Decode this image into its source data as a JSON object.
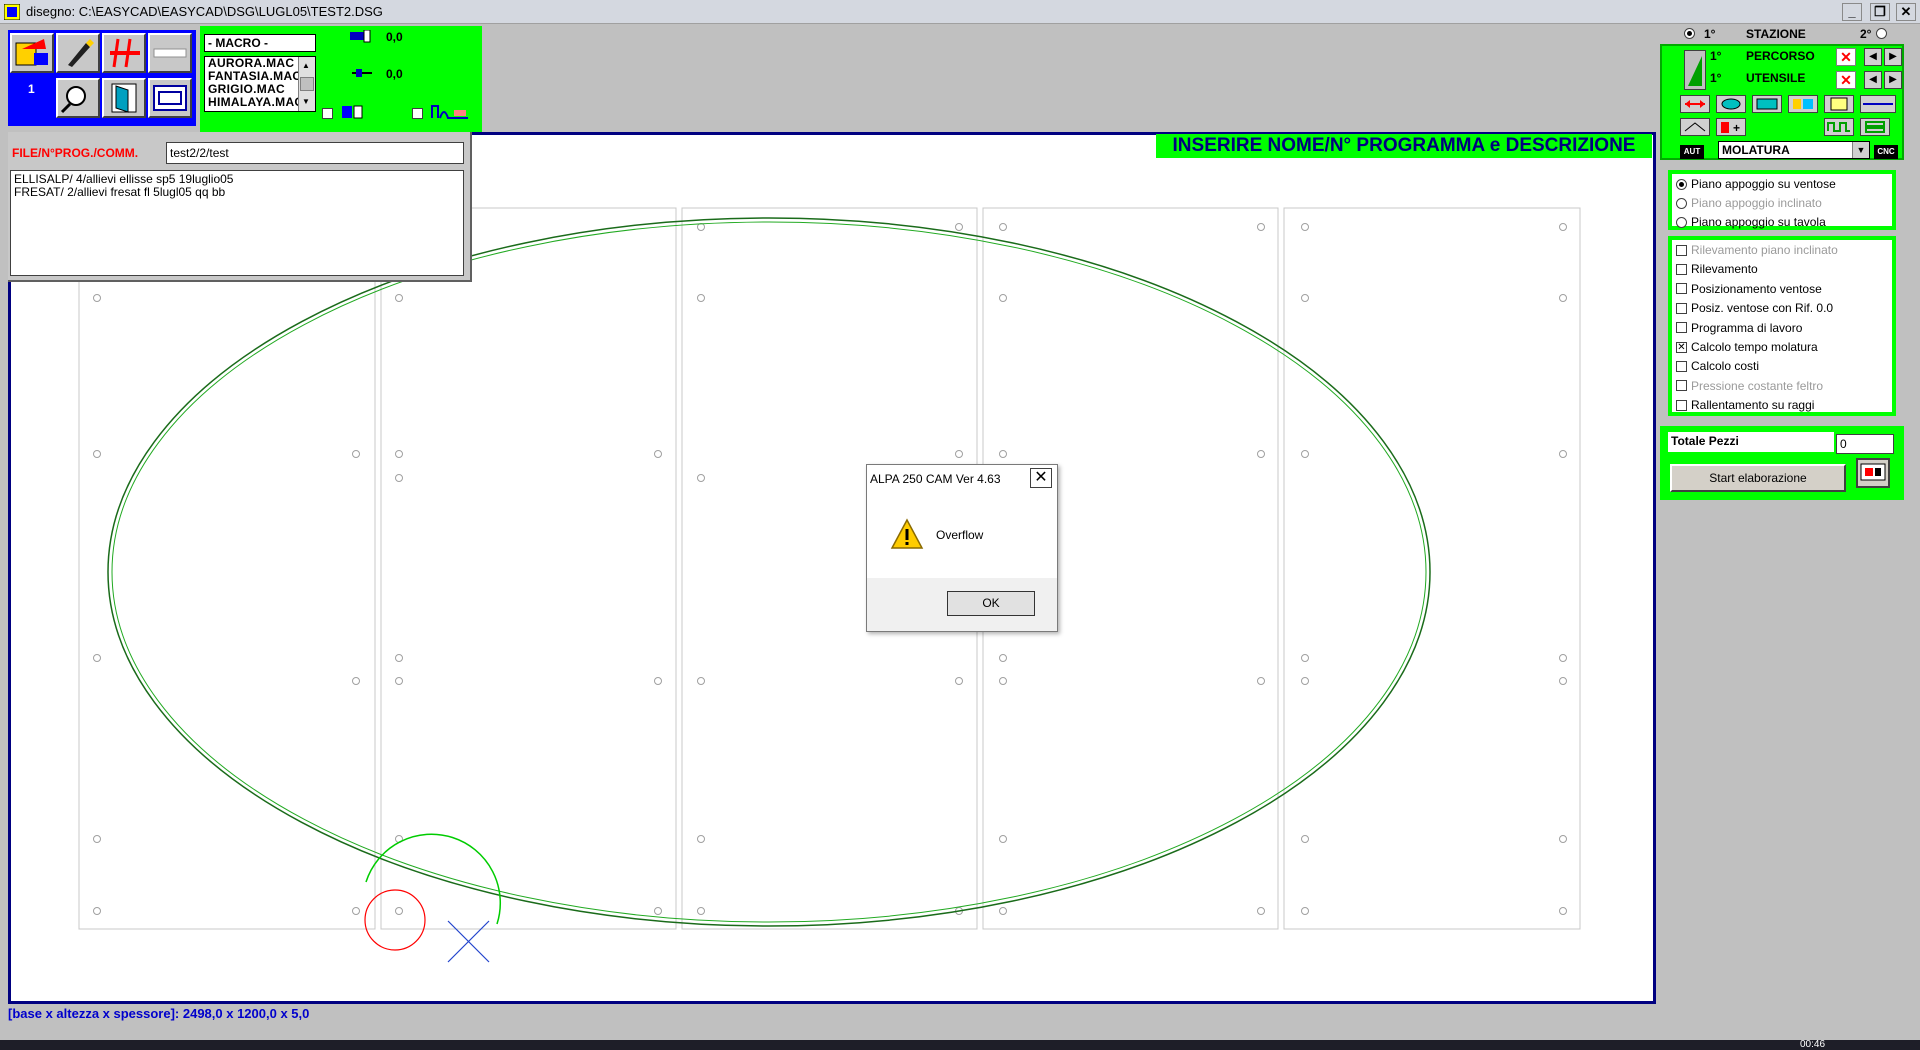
{
  "window": {
    "title": "disegno: C:\\EASYCAD\\EASYCAD\\DSG\\LUGL05\\TEST2.DSG",
    "controls": [
      "_",
      "❐",
      "✕"
    ]
  },
  "toolbar": {
    "number_label": "1",
    "macro": {
      "title": "- MACRO -",
      "items": [
        "AURORA.MAC",
        "FANTASIA.MAC",
        "GRIGIO.MAC",
        "HIMALAYA.MAC"
      ]
    },
    "value1": "0,0",
    "value2": "0,0"
  },
  "banner": {
    "prompt": "INSERIRE NOME/N° PROGRAMMA e DESCRIZIONE"
  },
  "file_panel": {
    "label": "FILE/N°PROG./COMM.",
    "value": "test2/2/test",
    "entries": [
      "ELLISALP/ 4/allievi ellisse sp5 19luglio05",
      "FRESAT/ 2/allievi fresat fl 5lugl05 qq bb"
    ]
  },
  "status": {
    "dimensions": "[base x altezza x spessore]: 2498,0 x 1200,0 x 5,0"
  },
  "right_panel": {
    "station_1": "1°",
    "station_label": "STAZIONE",
    "station_2": "2°",
    "percorso_num": "1°",
    "percorso_label": "PERCORSO",
    "utensile_num": "1°",
    "utensile_label": "UTENSILE",
    "aut_label": "AUT",
    "cnc_label": "CNC",
    "mode": "MOLATURA",
    "radio_options": [
      {
        "label": "Piano appoggio su ventose",
        "selected": true,
        "enabled": true
      },
      {
        "label": "Piano appoggio inclinato",
        "selected": false,
        "enabled": false
      },
      {
        "label": "Piano appoggio su tavola",
        "selected": false,
        "enabled": true
      }
    ],
    "check_options": [
      {
        "label": "Rilevamento piano inclinato",
        "checked": false,
        "enabled": false
      },
      {
        "label": "Rilevamento",
        "checked": false,
        "enabled": true
      },
      {
        "label": "Posizionamento ventose",
        "checked": false,
        "enabled": true
      },
      {
        "label": "Posiz. ventose con Rif. 0.0",
        "checked": false,
        "enabled": true
      },
      {
        "label": "Programma di lavoro",
        "checked": false,
        "enabled": true
      },
      {
        "label": "Calcolo tempo molatura",
        "checked": true,
        "enabled": true
      },
      {
        "label": "Calcolo costi",
        "checked": false,
        "enabled": true
      },
      {
        "label": "Pressione costante feltro",
        "checked": false,
        "enabled": false
      },
      {
        "label": "Rallentamento su raggi",
        "checked": false,
        "enabled": true
      }
    ],
    "totale_label": "Totale Pezzi",
    "totale_value": "0",
    "start_label": "Start elaborazione"
  },
  "dialog": {
    "title": "ALPA 250 CAM Ver 4.63",
    "message": "Overflow",
    "ok_label": "OK",
    "close_glyph": "✕"
  },
  "taskbar": {
    "clock": "00:46"
  },
  "colors": {
    "panel_green": "#00ff00",
    "canvas_border": "#000080",
    "shape_green": "#007700",
    "tool_red": "#ff0000"
  }
}
